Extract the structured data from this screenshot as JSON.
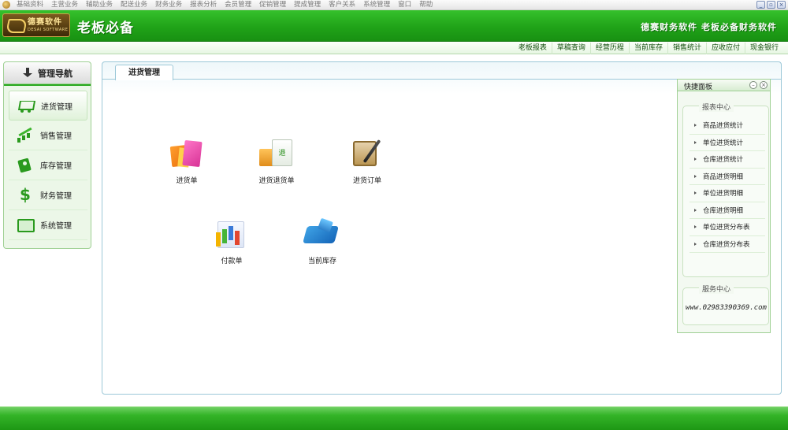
{
  "menu": [
    "基础资料",
    "主营业务",
    "辅助业务",
    "配送业务",
    "财务业务",
    "报表分析",
    "会员管理",
    "促销管理",
    "提成管理",
    "客户关系",
    "系统管理",
    "窗口",
    "帮助"
  ],
  "window_controls": {
    "minimize": "_",
    "restore": "▫",
    "close": "×"
  },
  "banner": {
    "logo_cn": "德赛软件",
    "logo_en": "DESAI SOFTWARE",
    "slogan": "老板必备",
    "right_text": "德赛财务软件  老板必备财务软件"
  },
  "quick_links": [
    "老板报表",
    "草稿查询",
    "经营历程",
    "当前库存",
    "销售统计",
    "应收应付",
    "现金银行"
  ],
  "nav": {
    "header": "管理导航",
    "items": [
      {
        "label": "进货管理",
        "icon": "cart-icon",
        "active": true
      },
      {
        "label": "销售管理",
        "icon": "sales-chart-icon"
      },
      {
        "label": "库存管理",
        "icon": "inventory-icon"
      },
      {
        "label": "财务管理",
        "icon": "dollar-icon"
      },
      {
        "label": "系统管理",
        "icon": "monitor-icon"
      }
    ]
  },
  "main": {
    "tab": "进货管理",
    "modules": [
      {
        "label": "进货单",
        "icon": "shopping-bags-icon"
      },
      {
        "label": "进货退货单",
        "icon": "return-box-icon"
      },
      {
        "label": "进货订单",
        "icon": "order-book-icon"
      },
      {
        "label": "付款单",
        "icon": "payment-chart-icon"
      },
      {
        "label": "当前库存",
        "icon": "inventory-stock-icon"
      }
    ]
  },
  "quick_panel": {
    "title": "快捷面板",
    "report_center": {
      "title": "报表中心",
      "items": [
        "商品进货统计",
        "单位进货统计",
        "仓库进货统计",
        "商品进货明细",
        "单位进货明细",
        "仓库进货明细",
        "单位进货分布表",
        "仓库进货分布表"
      ]
    },
    "service_center": {
      "title": "服务中心",
      "text": "www.02983390369.com"
    }
  }
}
